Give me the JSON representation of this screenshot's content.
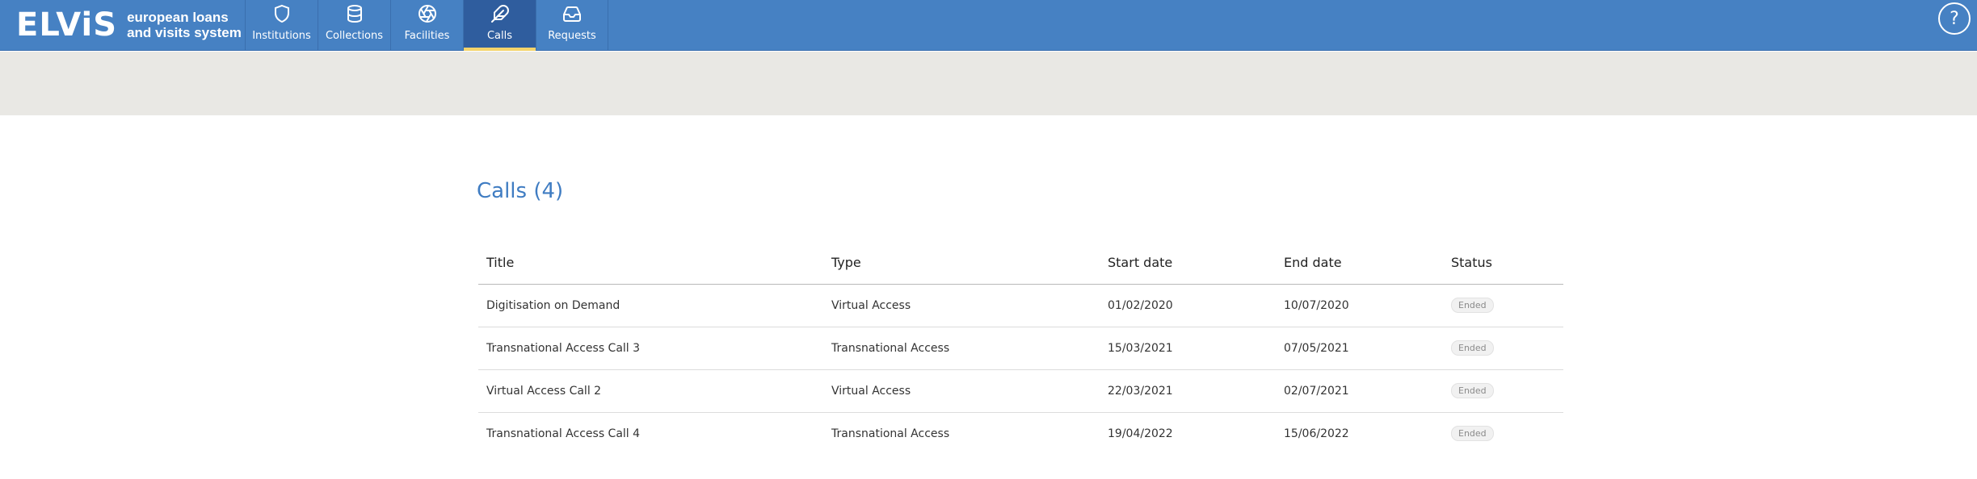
{
  "app": {
    "logo_text": "ELViS",
    "logo_sub_line1": "european loans",
    "logo_sub_line2": "and visits system",
    "brand_color": "#4681c3",
    "accent_color": "#f3d36b"
  },
  "nav": {
    "items": [
      {
        "label": "Institutions",
        "icon": "shield-icon",
        "active": false
      },
      {
        "label": "Collections",
        "icon": "database-icon",
        "active": false
      },
      {
        "label": "Facilities",
        "icon": "aperture-icon",
        "active": false
      },
      {
        "label": "Calls",
        "icon": "feather-icon",
        "active": true
      },
      {
        "label": "Requests",
        "icon": "inbox-icon",
        "active": false
      }
    ],
    "help_label": "?"
  },
  "main": {
    "title": "Calls (4)",
    "table": {
      "columns": [
        "Title",
        "Type",
        "Start date",
        "End date",
        "Status"
      ],
      "rows": [
        {
          "title": "Digitisation on Demand",
          "type": "Virtual Access",
          "start": "01/02/2020",
          "end": "10/07/2020",
          "status": "Ended"
        },
        {
          "title": "Transnational Access Call 3",
          "type": "Transnational Access",
          "start": "15/03/2021",
          "end": "07/05/2021",
          "status": "Ended"
        },
        {
          "title": "Virtual Access Call 2",
          "type": "Virtual Access",
          "start": "22/03/2021",
          "end": "02/07/2021",
          "status": "Ended"
        },
        {
          "title": "Transnational Access Call 4",
          "type": "Transnational Access",
          "start": "19/04/2022",
          "end": "15/06/2022",
          "status": "Ended"
        }
      ]
    }
  }
}
